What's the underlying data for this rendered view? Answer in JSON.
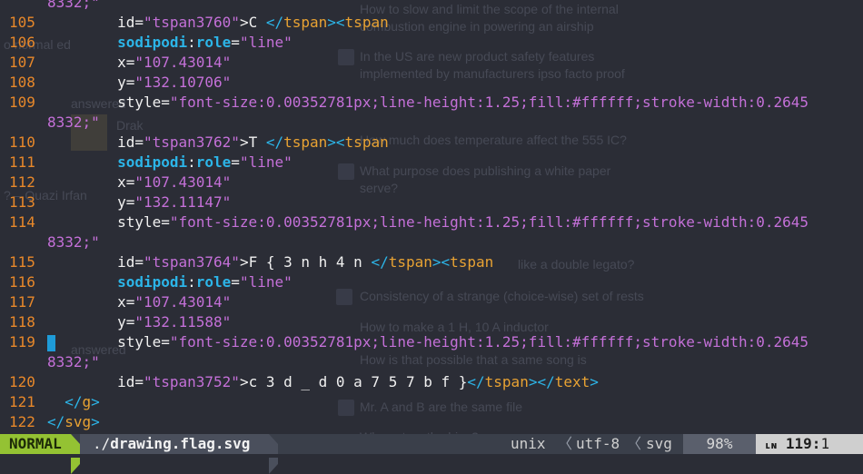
{
  "editor": {
    "cursor_line_marker": "119",
    "lines": [
      {
        "num": "",
        "parts": [
          {
            "t": "wrap",
            "v": "8332;\""
          }
        ]
      },
      {
        "num": "105",
        "parts": [
          {
            "t": "txt",
            "v": "        id="
          },
          {
            "t": "str",
            "v": "\"tspan3760\""
          },
          {
            "t": "txt",
            "v": ">C "
          },
          {
            "t": "brk",
            "v": "</"
          },
          {
            "t": "tag",
            "v": "tspan"
          },
          {
            "t": "brk",
            "v": "><"
          },
          {
            "t": "tag",
            "v": "tspan"
          }
        ]
      },
      {
        "num": "106",
        "parts": [
          {
            "t": "kw",
            "v": "        sodipodi"
          },
          {
            "t": "txt",
            "v": ":"
          },
          {
            "t": "kw",
            "v": "role"
          },
          {
            "t": "txt",
            "v": "="
          },
          {
            "t": "str",
            "v": "\"line\""
          }
        ]
      },
      {
        "num": "107",
        "parts": [
          {
            "t": "txt",
            "v": "        x="
          },
          {
            "t": "str",
            "v": "\"107.43014\""
          }
        ]
      },
      {
        "num": "108",
        "parts": [
          {
            "t": "txt",
            "v": "        y="
          },
          {
            "t": "str",
            "v": "\"132.10706\""
          }
        ]
      },
      {
        "num": "109",
        "parts": [
          {
            "t": "txt",
            "v": "        style="
          },
          {
            "t": "str",
            "v": "\"font-size:0.00352781px;line-height:1.25;fill:#ffffff;stroke-width:0.2645"
          }
        ]
      },
      {
        "num": "",
        "parts": [
          {
            "t": "wrap",
            "v": "8332;\""
          }
        ]
      },
      {
        "num": "110",
        "parts": [
          {
            "t": "txt",
            "v": "        id="
          },
          {
            "t": "str",
            "v": "\"tspan3762\""
          },
          {
            "t": "txt",
            "v": ">T "
          },
          {
            "t": "brk",
            "v": "</"
          },
          {
            "t": "tag",
            "v": "tspan"
          },
          {
            "t": "brk",
            "v": "><"
          },
          {
            "t": "tag",
            "v": "tspan"
          }
        ]
      },
      {
        "num": "111",
        "parts": [
          {
            "t": "kw",
            "v": "        sodipodi"
          },
          {
            "t": "txt",
            "v": ":"
          },
          {
            "t": "kw",
            "v": "role"
          },
          {
            "t": "txt",
            "v": "="
          },
          {
            "t": "str",
            "v": "\"line\""
          }
        ]
      },
      {
        "num": "112",
        "parts": [
          {
            "t": "txt",
            "v": "        x="
          },
          {
            "t": "str",
            "v": "\"107.43014\""
          }
        ]
      },
      {
        "num": "113",
        "parts": [
          {
            "t": "txt",
            "v": "        y="
          },
          {
            "t": "str",
            "v": "\"132.11147\""
          }
        ]
      },
      {
        "num": "114",
        "parts": [
          {
            "t": "txt",
            "v": "        style="
          },
          {
            "t": "str",
            "v": "\"font-size:0.00352781px;line-height:1.25;fill:#ffffff;stroke-width:0.2645"
          }
        ]
      },
      {
        "num": "",
        "parts": [
          {
            "t": "wrap",
            "v": "8332;\""
          }
        ]
      },
      {
        "num": "115",
        "parts": [
          {
            "t": "txt",
            "v": "        id="
          },
          {
            "t": "str",
            "v": "\"tspan3764\""
          },
          {
            "t": "txt",
            "v": ">F { 3 n h 4 n "
          },
          {
            "t": "brk",
            "v": "</"
          },
          {
            "t": "tag",
            "v": "tspan"
          },
          {
            "t": "brk",
            "v": "><"
          },
          {
            "t": "tag",
            "v": "tspan"
          }
        ]
      },
      {
        "num": "116",
        "parts": [
          {
            "t": "kw",
            "v": "        sodipodi"
          },
          {
            "t": "txt",
            "v": ":"
          },
          {
            "t": "kw",
            "v": "role"
          },
          {
            "t": "txt",
            "v": "="
          },
          {
            "t": "str",
            "v": "\"line\""
          }
        ]
      },
      {
        "num": "117",
        "parts": [
          {
            "t": "txt",
            "v": "        x="
          },
          {
            "t": "str",
            "v": "\"107.43014\""
          }
        ]
      },
      {
        "num": "118",
        "parts": [
          {
            "t": "txt",
            "v": "        y="
          },
          {
            "t": "str",
            "v": "\"132.11588\""
          }
        ]
      },
      {
        "num": "119",
        "parts": [
          {
            "t": "txt",
            "v": "        style="
          },
          {
            "t": "str",
            "v": "\"font-size:0.00352781px;line-height:1.25;fill:#ffffff;stroke-width:0.2645"
          }
        ]
      },
      {
        "num": "",
        "parts": [
          {
            "t": "wrap",
            "v": "8332;\""
          }
        ]
      },
      {
        "num": "120",
        "parts": [
          {
            "t": "txt",
            "v": "        id="
          },
          {
            "t": "str",
            "v": "\"tspan3752\""
          },
          {
            "t": "txt",
            "v": ">c 3 d _ d 0 a 7 5 7 b f }"
          },
          {
            "t": "brk",
            "v": "</"
          },
          {
            "t": "tag",
            "v": "tspan"
          },
          {
            "t": "brk",
            "v": "></"
          },
          {
            "t": "tag",
            "v": "text"
          },
          {
            "t": "brk",
            "v": ">"
          }
        ]
      },
      {
        "num": "121",
        "parts": [
          {
            "t": "txt",
            "v": "  "
          },
          {
            "t": "brk",
            "v": "</"
          },
          {
            "t": "tag",
            "v": "g"
          },
          {
            "t": "brk",
            "v": ">"
          }
        ]
      },
      {
        "num": "122",
        "parts": [
          {
            "t": "brk",
            "v": "</"
          },
          {
            "t": "tag",
            "v": "svg"
          },
          {
            "t": "brk",
            "v": ">"
          }
        ]
      }
    ]
  },
  "statusline": {
    "mode": "NORMAL",
    "file_dir": "./",
    "file_name": "drawing.flag.svg",
    "fileformat": "unix",
    "encoding": "utf-8",
    "filetype": "svg",
    "percent": "98%",
    "line_icon": "ʟɴ",
    "line": "119",
    "col": "1"
  },
  "background_ghost": [
    "How to slow and limit the scope of the internal",
    "combustion engine in powering an airship",
    "o normal ed",
    "In the US are new product safety features",
    "implemented by manufacturers ipso facto proof",
    "answered",
    "Drak",
    "How much does temperature affect the 555 IC?",
    "What purpose does publishing a white paper",
    "serve?",
    "? – Quazi Irfan",
    "like a double legato?",
    "Consistency of a strange (choice-wise) set of rests",
    "How to make a 1 H, 10 A inductor",
    "How is that possible that a same song is",
    "answered",
    "Mr. A and B are the same file",
    "Why cut on the bias?"
  ]
}
